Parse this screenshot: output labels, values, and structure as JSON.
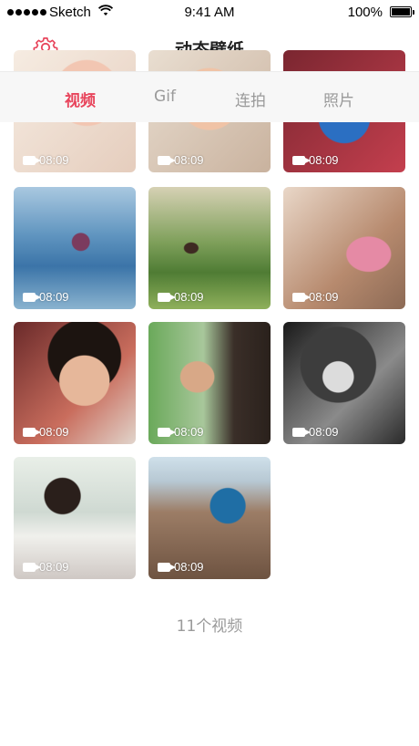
{
  "status_bar": {
    "carrier": "Sketch",
    "time": "9:41 AM",
    "battery": "100%",
    "battery_level": 1.0
  },
  "nav": {
    "title": "动态壁纸",
    "settings_icon": "gear-icon"
  },
  "tabs": [
    {
      "label": "视频",
      "active": true
    },
    {
      "label": "Gif",
      "active": false
    },
    {
      "label": "连拍",
      "active": false
    },
    {
      "label": "照片",
      "active": false
    }
  ],
  "accent_color": "#e8455c",
  "videos": [
    {
      "duration": "08:09"
    },
    {
      "duration": "08:09"
    },
    {
      "duration": "08:09"
    },
    {
      "duration": "08:09"
    },
    {
      "duration": "08:09"
    },
    {
      "duration": "08:09"
    },
    {
      "duration": "08:09"
    },
    {
      "duration": "08:09"
    },
    {
      "duration": "08:09"
    },
    {
      "duration": "08:09"
    },
    {
      "duration": "08:09"
    }
  ],
  "footer": {
    "count_text": "11个视频"
  }
}
